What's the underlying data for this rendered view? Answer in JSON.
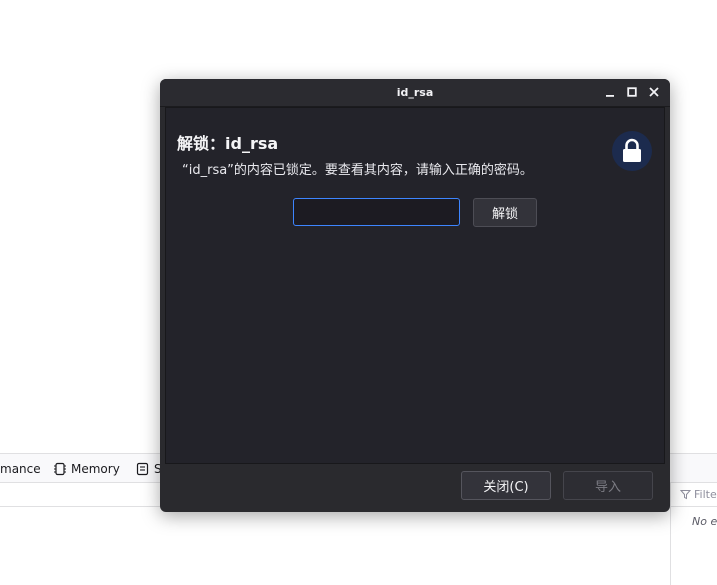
{
  "background_app": {
    "toolbar": {
      "tabs": [
        {
          "label": "mance",
          "icon": ""
        },
        {
          "label": "Memory",
          "icon": "memory-chip-icon"
        },
        {
          "label": "S",
          "icon": "storage-icon"
        }
      ]
    },
    "filter_placeholder": "Filte",
    "empty_text": "No e"
  },
  "dialog": {
    "window_title": "id_rsa",
    "heading": "解锁：id_rsa",
    "description": "“id_rsa”的内容已锁定。要查看其内容，请输入正确的密码。",
    "password_value": "",
    "unlock_label": "解锁",
    "close_label": "关闭(C)",
    "import_label": "导入",
    "lock_icon": "lock-icon"
  },
  "colors": {
    "accent": "#3d85ff",
    "window_bg": "#2a2a2e",
    "content_bg": "#23232a",
    "lock_badge_bg": "#1c2b4e"
  }
}
